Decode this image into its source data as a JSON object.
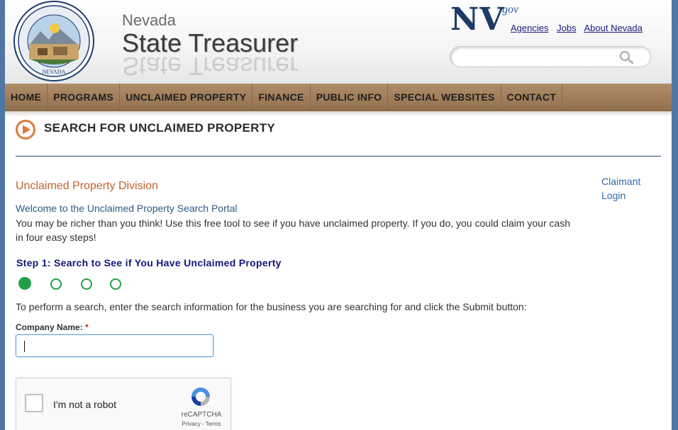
{
  "header": {
    "brand_top": "Nevada",
    "brand_main": "State Treasurer",
    "seal_text": "OFFICE OF THE STATE TREASURER NEVADA",
    "nv_logo": "NV",
    "nv_gov": ".gov",
    "top_links": [
      "Agencies",
      "Jobs",
      "About Nevada"
    ],
    "search": {
      "placeholder": "",
      "value": ""
    }
  },
  "nav": {
    "items": [
      "HOME",
      "PROGRAMS",
      "UNCLAIMED PROPERTY",
      "FINANCE",
      "PUBLIC INFO",
      "SPECIAL WEBSITES",
      "CONTACT"
    ]
  },
  "page": {
    "title": "SEARCH FOR UNCLAIMED PROPERTY",
    "division": "Unclaimed Property Division",
    "claimant_login": "Claimant Login",
    "welcome": "Welcome to the Unclaimed Property Search Portal",
    "intro": "You may be richer than you think! Use this free tool to see if you have unclaimed property. If you do, you could claim your cash in four easy steps!",
    "step_title": "Step 1: Search to See if You Have Unclaimed Property",
    "steps_total": 4,
    "current_step": 1,
    "instruction": "To perform a search, enter the search information for the business you are searching for and click the Submit button:",
    "company_label": "Company Name:",
    "required_mark": "*",
    "company_value": ""
  },
  "recaptcha": {
    "label": "I'm not a robot",
    "brand": "reCAPTCHA",
    "links": "Privacy - Terms"
  },
  "colors": {
    "background": "#4f77a3",
    "nav": "#a27f5c",
    "accent_orange": "#c0622e",
    "step_green": "#23a047",
    "link_blue": "#2e6aa8"
  }
}
